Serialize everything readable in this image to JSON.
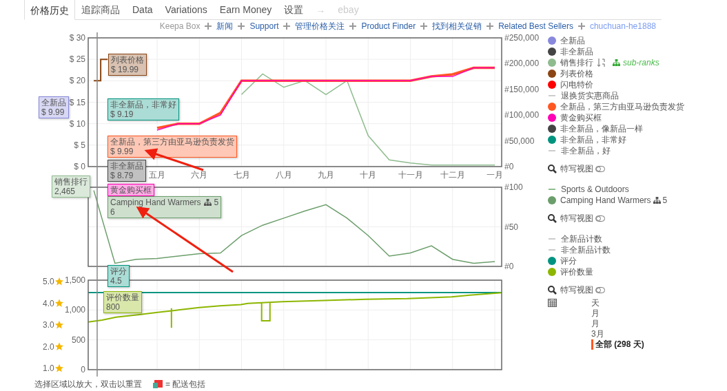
{
  "tabs": [
    {
      "label": "价格历史",
      "selected": true,
      "disabled": false
    },
    {
      "label": "追踪商品",
      "selected": false,
      "disabled": false
    },
    {
      "label": "Data",
      "selected": false,
      "disabled": false
    },
    {
      "label": "Variations",
      "selected": false,
      "disabled": false
    },
    {
      "label": "Earn Money",
      "selected": false,
      "disabled": false
    },
    {
      "label": "设置",
      "selected": false,
      "disabled": false
    },
    {
      "label": "→",
      "selected": false,
      "disabled": true
    },
    {
      "label": "ebay",
      "selected": false,
      "disabled": true
    }
  ],
  "links": [
    {
      "label": "Keepa Box",
      "kind": "muted"
    },
    {
      "label": "新闻",
      "kind": "link"
    },
    {
      "label": "Support",
      "kind": "link"
    },
    {
      "label": "管理价格关注",
      "kind": "link"
    },
    {
      "label": "Product Finder",
      "kind": "link"
    },
    {
      "label": "找到相关促销",
      "kind": "link"
    },
    {
      "label": "Related Best Sellers",
      "kind": "link"
    },
    {
      "label": "chuchuan-he1888",
      "kind": "user"
    }
  ],
  "price_chart": {
    "chart_data": {
      "type": "line",
      "categories": [
        null,
        null,
        null,
        "五月",
        null,
        "六月",
        null,
        "七月",
        null,
        "八月",
        null,
        "九月",
        null,
        "十月",
        null,
        "十一月",
        null,
        "十二月",
        null,
        "一月"
      ],
      "series": [
        {
          "color": "#ff5722",
          "values": [
            null,
            null,
            null,
            9,
            10,
            10,
            12.5,
            20,
            20,
            20,
            20,
            20,
            20,
            20,
            20,
            20,
            21,
            21.5,
            23,
            23
          ]
        },
        {
          "color": "#ff00b4",
          "values": [
            null,
            null,
            null,
            8.5,
            10,
            10,
            12,
            20,
            20,
            20,
            20,
            20,
            20,
            20,
            20,
            20,
            21,
            21,
            23,
            23
          ]
        }
      ],
      "ylim": [
        0,
        30
      ],
      "grid": true,
      "yticks": [
        {
          "value": 0,
          "label": "$ 0"
        },
        {
          "value": 5,
          "label": "$ 5"
        },
        {
          "value": 10,
          "label": "$ 10"
        },
        {
          "value": 15,
          "label": "$ 15"
        },
        {
          "value": 20,
          "label": "$ 20"
        },
        {
          "value": 25,
          "label": "$ 25"
        },
        {
          "value": 30,
          "label": "$ 30"
        }
      ]
    }
  },
  "sales_rank_chart": {
    "chart_data": {
      "type": "line",
      "categories": [
        null,
        null,
        null,
        null,
        null,
        null,
        null,
        null,
        null,
        null,
        null,
        null,
        null,
        null,
        null,
        null,
        null,
        null,
        null,
        null
      ],
      "series": [
        {
          "color": "#8fbc8f",
          "values": [
            null,
            null,
            null,
            null,
            null,
            null,
            null,
            140000,
            180000,
            154000,
            167000,
            140000,
            167000,
            60000,
            13000,
            7000,
            3000,
            3000,
            3000,
            3000
          ]
        }
      ],
      "ylim": [
        0,
        250000
      ],
      "yticks": [
        {
          "value": 250000,
          "label": "#250,000"
        },
        {
          "value": 200000,
          "label": "#200,000"
        },
        {
          "value": 150000,
          "label": "#150,000"
        },
        {
          "value": 100000,
          "label": "#100,000"
        },
        {
          "value": 50000,
          "label": "#50,000"
        },
        {
          "value": 0,
          "label": "#0"
        }
      ]
    }
  },
  "rank_chart": {
    "chart_data": {
      "type": "line",
      "grid": true,
      "categories": [
        null,
        null,
        null,
        null,
        null,
        null,
        null,
        null,
        null,
        null,
        null,
        null,
        null,
        null,
        null,
        null,
        null,
        null,
        null,
        null
      ],
      "series": [
        {
          "color": "#6b9e6b",
          "values": [
            96,
            4,
            9,
            10,
            13,
            16,
            17,
            39,
            52,
            61,
            70,
            78,
            61,
            39,
            13,
            17,
            26,
            9,
            4,
            6
          ]
        }
      ],
      "ylim": [
        0,
        100
      ],
      "yticks": [
        {
          "value": 100,
          "label": "#100"
        },
        {
          "value": 50,
          "label": "#50"
        },
        {
          "value": 0,
          "label": "#0"
        }
      ]
    }
  },
  "review_chart": {
    "star_labels": [
      "5.0",
      "4.0",
      "3.0",
      "2.0",
      "1.0"
    ],
    "count_labels": [
      "1,500",
      "1,000",
      "500",
      "0"
    ]
  },
  "tooltips": [
    {
      "title": "列表价格",
      "value": "$ 19.99",
      "color": "#8b4513"
    },
    {
      "title": "全新品",
      "value": "$ 9.99",
      "color": "#8888dd"
    },
    {
      "title": "非全新品，非常好",
      "value": "$ 9.19",
      "color": "#009480"
    },
    {
      "title": "全新品，第三方由亚马逊负责发货",
      "value": "$ 9.99",
      "color": "#ff5722"
    },
    {
      "title": "非全新品",
      "value": "$ 8.79",
      "color": "#444444"
    },
    {
      "title": "销售排行",
      "value": "2,465",
      "color": "#8fbc8f"
    },
    {
      "title": "黄金购买框",
      "color": "#ff00b4"
    },
    {
      "title": "Camping Hand Warmers",
      "rank": "5",
      "value": "6",
      "color": "#6b9e6b"
    },
    {
      "title": "评分",
      "value": "4.5",
      "color": "#009480"
    },
    {
      "title": "评价数量",
      "value": "800",
      "color": "#8db600"
    }
  ],
  "legend_groups": [
    {
      "items": [
        {
          "label": "全新品",
          "kind": "dot",
          "color": "#8888dd"
        },
        {
          "label": "非全新品",
          "kind": "dot",
          "color": "#444444"
        },
        {
          "label": "销售排行",
          "kind": "dot",
          "color": "#8fbc8f",
          "extra": "sub-ranks"
        },
        {
          "label": "列表价格",
          "kind": "dot",
          "color": "#8b4513"
        },
        {
          "label": "闪电特价",
          "kind": "dot",
          "color": "#ff0000"
        },
        {
          "label": "退换货实惠商品",
          "kind": "line",
          "color": "#cccccc"
        },
        {
          "label": "全新品，第三方由亚马逊负责发货",
          "kind": "dot",
          "color": "#ff5722"
        },
        {
          "label": "黄金购买框",
          "kind": "dot",
          "color": "#ff00b4"
        },
        {
          "label": "非全新品，像新品一样",
          "kind": "dot",
          "color": "#444444"
        },
        {
          "label": "非全新品，非常好",
          "kind": "dot",
          "color": "#009480"
        },
        {
          "label": "非全新品，好",
          "kind": "line",
          "color": "#cccccc"
        }
      ],
      "closeup": "特写视图"
    },
    {
      "items": [
        {
          "label": "Sports & Outdoors",
          "kind": "line",
          "color": "#8fbc8f"
        },
        {
          "label": "Camping Hand Warmers",
          "kind": "dot",
          "color": "#6b9e6b",
          "rank": "5"
        }
      ],
      "closeup": "特写视图"
    },
    {
      "items": [
        {
          "label": "全新品计数",
          "kind": "line",
          "color": "#cccccc"
        },
        {
          "label": "非全新品计数",
          "kind": "line",
          "color": "#cccccc"
        },
        {
          "label": "评分",
          "kind": "dot",
          "color": "#009480"
        },
        {
          "label": "评价数量",
          "kind": "dot",
          "color": "#8db600"
        }
      ],
      "closeup": "特写视图"
    }
  ],
  "range_options": [
    {
      "label": "天",
      "selected": false
    },
    {
      "label": "月",
      "selected": false
    },
    {
      "label": "月",
      "selected": false
    },
    {
      "label": "3月",
      "selected": false
    },
    {
      "label": "全部 (298 天)",
      "selected": true
    }
  ],
  "footer": {
    "hint": "选择区域以放大，双击以重置",
    "note": "= 配送包括"
  }
}
